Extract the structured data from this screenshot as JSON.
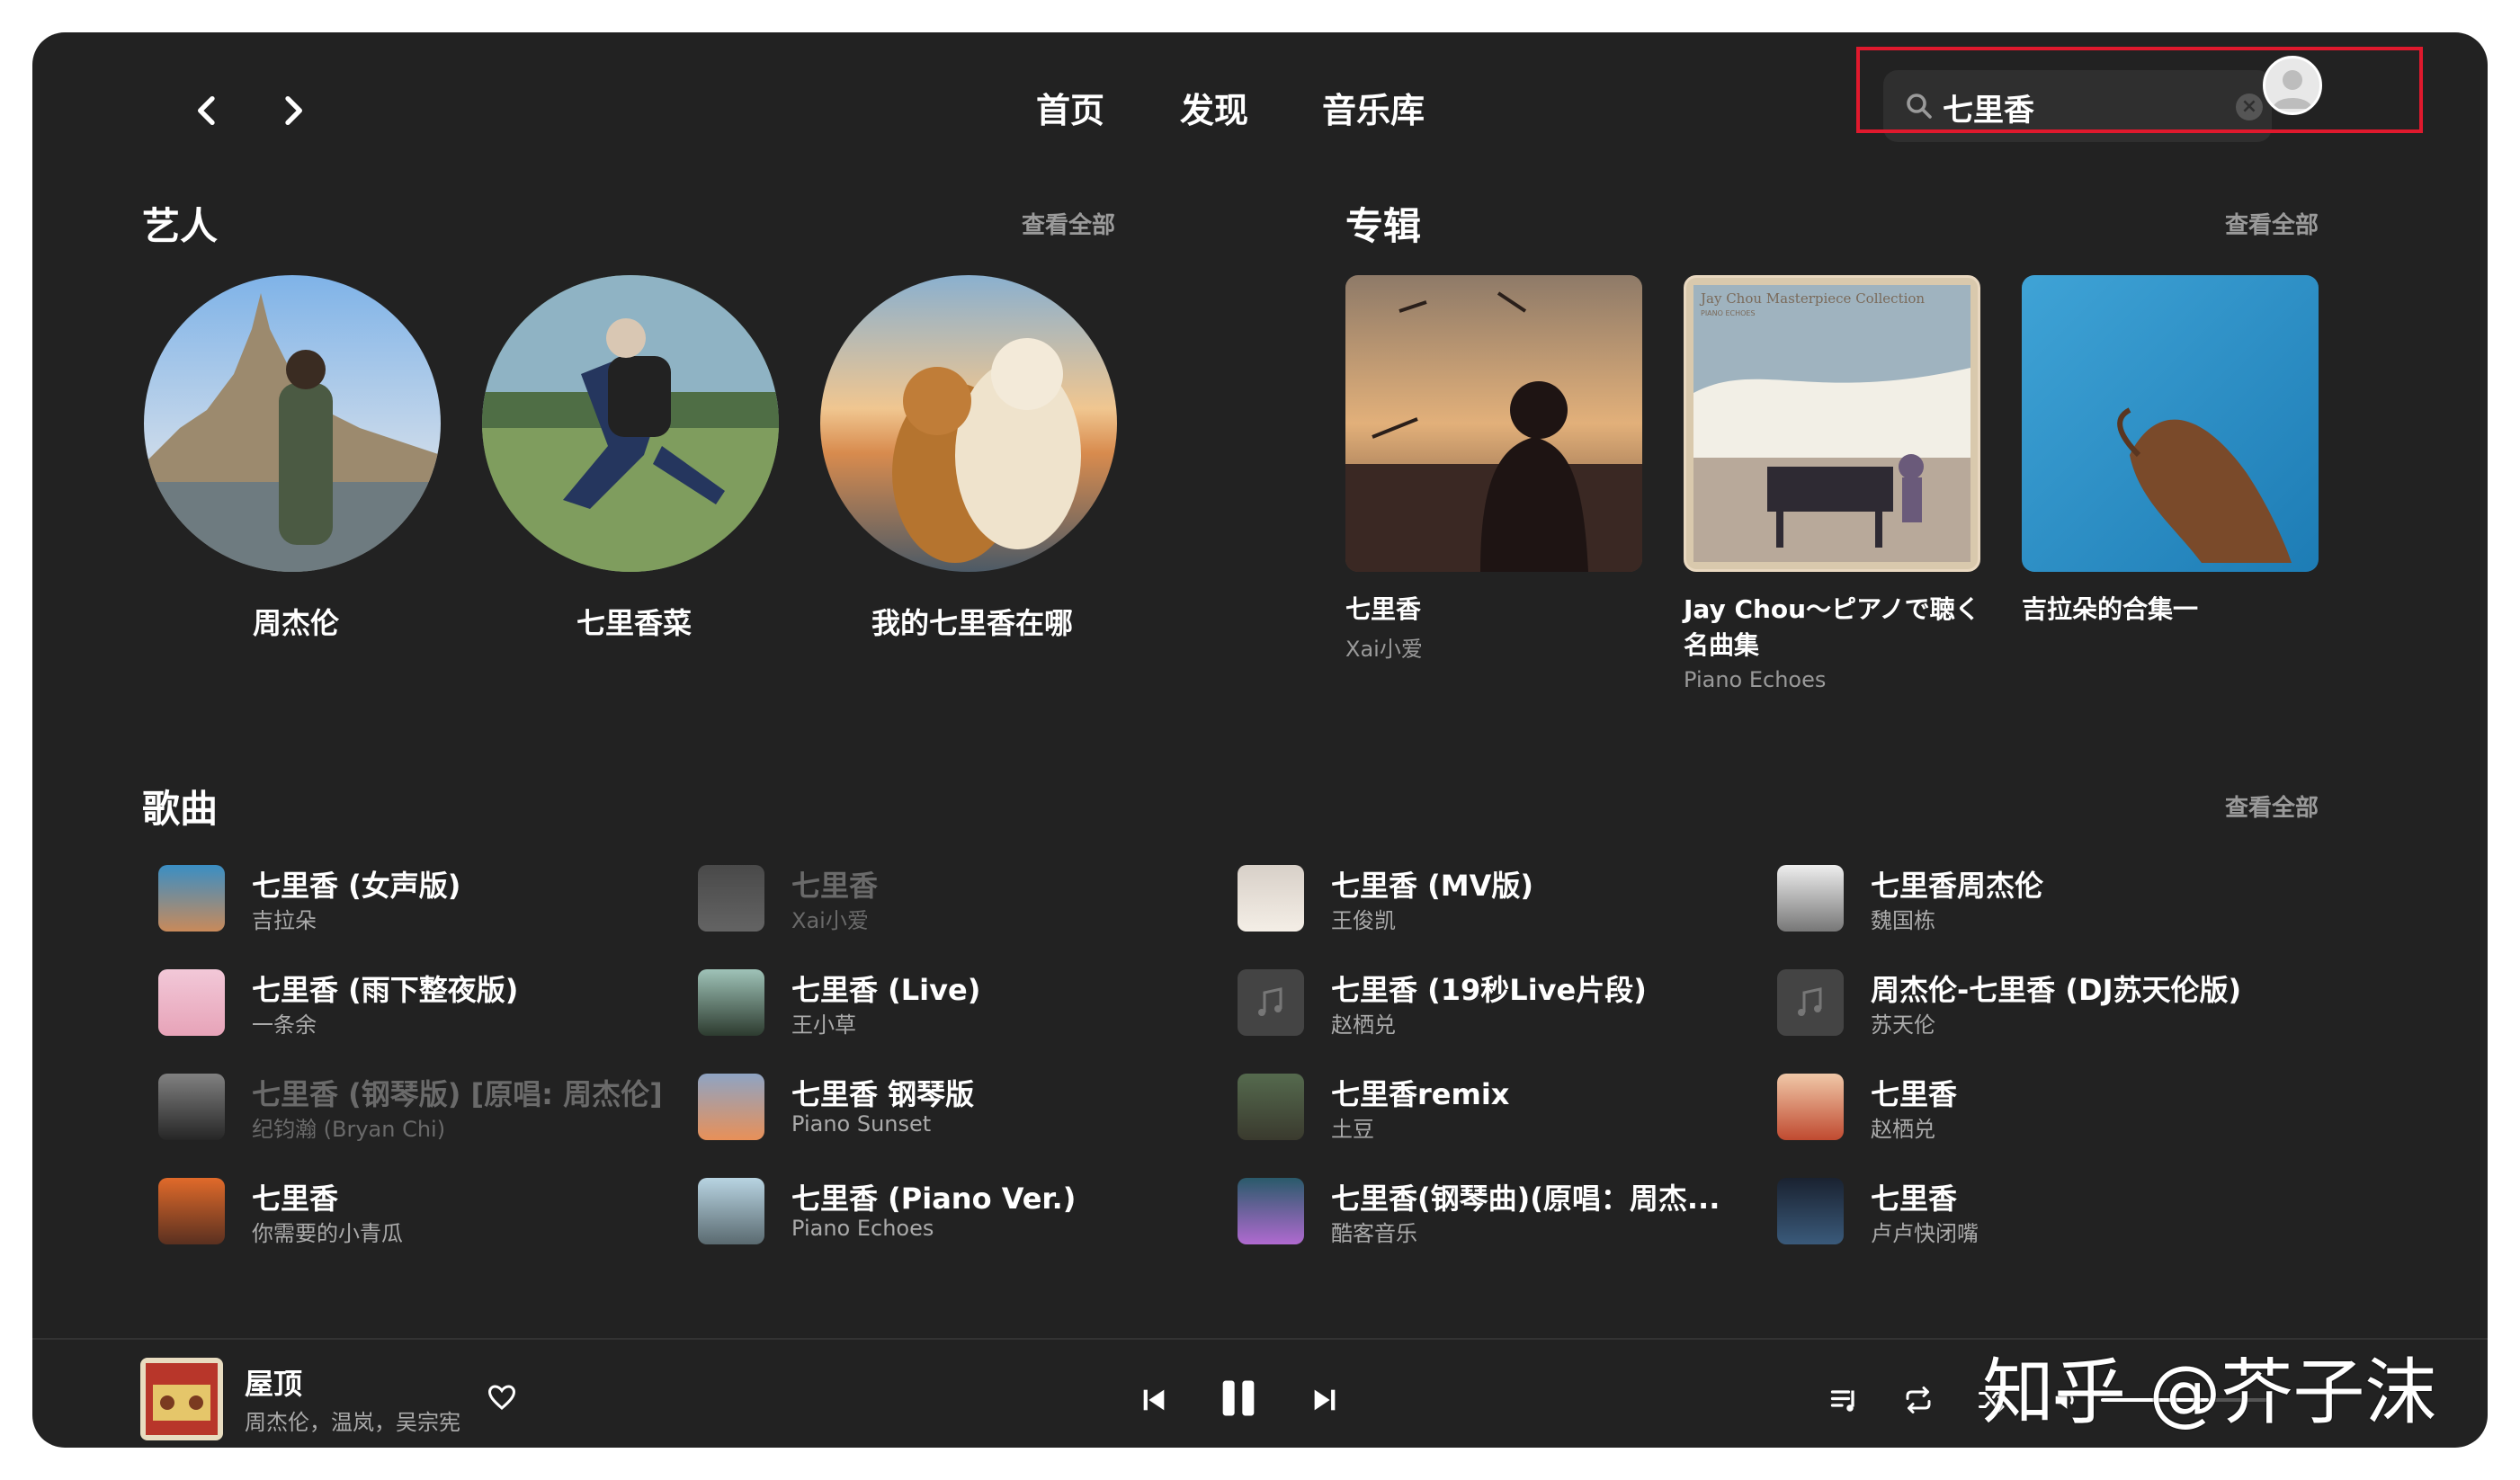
{
  "nav": {
    "back_icon": "chevron-left-icon",
    "forward_icon": "chevron-right-icon",
    "tabs": [
      "首页",
      "发现",
      "音乐库"
    ]
  },
  "search": {
    "value": "七里香",
    "icon": "search-icon",
    "clear_icon": "clear-icon"
  },
  "user": {
    "avatar_icon": "user-avatar-icon"
  },
  "artists": {
    "title": "艺人",
    "see_all": "查看全部",
    "items": [
      {
        "name": "周杰伦"
      },
      {
        "name": "七里香菜"
      },
      {
        "name": "我的七里香在哪"
      }
    ]
  },
  "albums": {
    "title": "专辑",
    "see_all": "查看全部",
    "items": [
      {
        "title": "七里香",
        "artist": "Xai小爱"
      },
      {
        "title": "Jay Chou～ピアノで聴く名曲集",
        "artist": "Piano Echoes",
        "cover_text": "Jay Chou Masterpiece Collection",
        "cover_sub": "PIANO ECHOES"
      },
      {
        "title": "吉拉朵的合集一",
        "artist": ""
      }
    ]
  },
  "songs": {
    "title": "歌曲",
    "see_all": "查看全部",
    "items": [
      {
        "title": "七里香 (女声版)",
        "artist": "吉拉朵",
        "dim": false
      },
      {
        "title": "七里香",
        "artist": "Xai小爱",
        "dim": true
      },
      {
        "title": "七里香 (MV版)",
        "artist": "王俊凯",
        "dim": false
      },
      {
        "title": "七里香周杰伦",
        "artist": "魏国栋",
        "dim": false
      },
      {
        "title": "七里香 (雨下整夜版)",
        "artist": "一条余",
        "dim": false
      },
      {
        "title": "七里香 (Live)",
        "artist": "王小草",
        "dim": false
      },
      {
        "title": "七里香 (19秒Live片段)",
        "artist": "赵栖兑",
        "dim": false
      },
      {
        "title": "周杰伦-七里香 (DJ苏天伦版)",
        "artist": "苏天伦",
        "dim": false
      },
      {
        "title": "七里香 (钢琴版) [原唱: 周杰伦]",
        "artist": "纪钧瀚 (Bryan Chi)",
        "dim": true
      },
      {
        "title": "七里香 钢琴版",
        "artist": "Piano Sunset",
        "dim": false
      },
      {
        "title": "七里香remix",
        "artist": "土豆",
        "dim": false
      },
      {
        "title": "七里香",
        "artist": "赵栖兑",
        "dim": false
      },
      {
        "title": "七里香",
        "artist": "你需要的小青瓜",
        "dim": false
      },
      {
        "title": "七里香 (Piano Ver.)",
        "artist": "Piano Echoes",
        "dim": false
      },
      {
        "title": "七里香(钢琴曲)(原唱：周杰...",
        "artist": "酷客音乐",
        "dim": false
      },
      {
        "title": "七里香",
        "artist": "卢卢快闭嘴",
        "dim": false
      }
    ]
  },
  "player": {
    "title": "屋顶",
    "artist": "周杰伦，温岚，吴宗宪",
    "like_icon": "heart-icon",
    "prev_icon": "previous-icon",
    "pause_icon": "pause-icon",
    "next_icon": "next-icon",
    "playlist_icon": "playlist-icon",
    "repeat_icon": "repeat-icon",
    "shuffle_icon": "shuffle-icon",
    "volume_icon": "volume-icon"
  },
  "watermark": "知乎 @芥子沫",
  "colors": {
    "background": "#222222",
    "highlight_box": "#e0192d",
    "muted_text": "#9a9a9a"
  }
}
